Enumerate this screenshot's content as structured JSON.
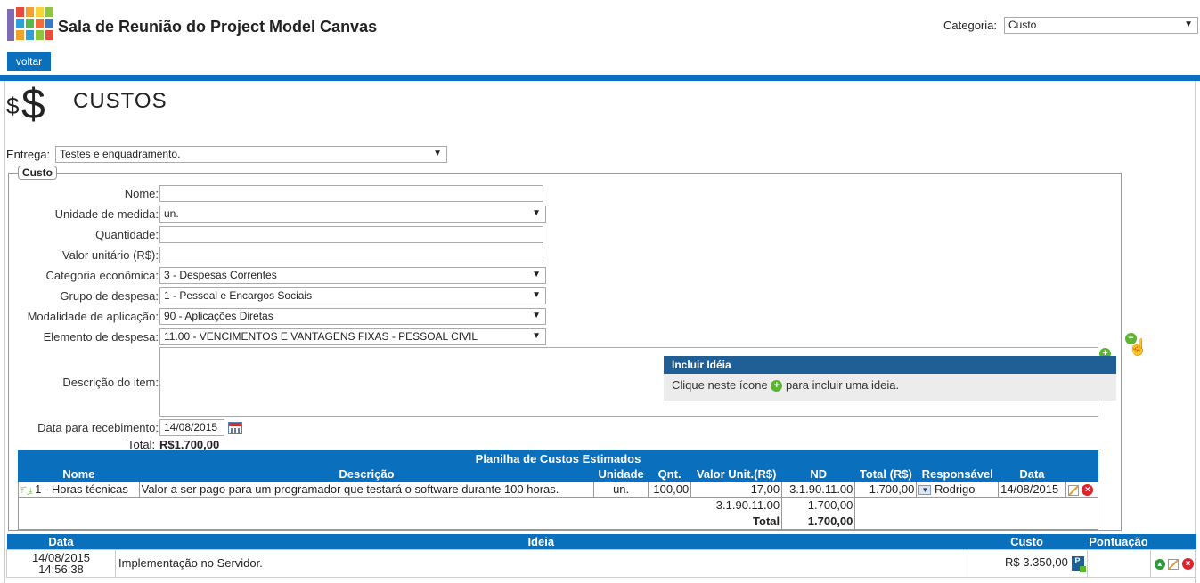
{
  "app": {
    "title": "Sala de Reunião do Project Model Canvas"
  },
  "header": {
    "category_label": "Categoria:",
    "category_value": "Custo",
    "back_button": "voltar"
  },
  "section": {
    "dollar_small": "$",
    "dollar_large": "$",
    "title": "CUSTOS"
  },
  "entrega": {
    "label": "Entrega:",
    "value": "Testes e enquadramento."
  },
  "form": {
    "legend": "Custo",
    "fields": {
      "nome": {
        "label": "Nome:",
        "value": ""
      },
      "unidade": {
        "label": "Unidade de medida:",
        "value": "un."
      },
      "quantidade": {
        "label": "Quantidade:",
        "value": ""
      },
      "valor_unitario": {
        "label": "Valor unitário (R$):",
        "value": ""
      },
      "categoria_economica": {
        "label": "Categoria econômica:",
        "value": "3 - Despesas Correntes"
      },
      "grupo_despesa": {
        "label": "Grupo de despesa:",
        "value": "1 - Pessoal e Encargos Sociais"
      },
      "modalidade": {
        "label": "Modalidade de aplicação:",
        "value": "90 - Aplicações Diretas"
      },
      "elemento": {
        "label": "Elemento de despesa:",
        "value": "11.00 - VENCIMENTOS E VANTAGENS FIXAS - PESSOAL CIVIL"
      },
      "descricao": {
        "label": "Descrição do item:",
        "value": ""
      },
      "data_recebimento": {
        "label": "Data para recebimento:",
        "value": "14/08/2015"
      }
    },
    "total_label": "Total:",
    "total_value": "R$1.700,00"
  },
  "tooltip": {
    "title": "Incluir Idéia",
    "text_before": "Clique neste ícone",
    "text_after": "para incluir uma ideia."
  },
  "planilha": {
    "title": "Planilha de Custos Estimados",
    "headers": [
      "Nome",
      "Descrição",
      "Unidade",
      "Qnt.",
      "Valor Unit.(R$)",
      "ND",
      "Total (R$)",
      "Responsável",
      "Data"
    ],
    "rows": [
      {
        "nome": "1 - Horas técnicas",
        "descricao": "Valor a ser pago para um programador que testará o software durante 100 horas.",
        "unidade": "un.",
        "qnt": "100,00",
        "valor_unit": "17,00",
        "nd": "3.1.90.11.00",
        "total": "1.700,00",
        "responsavel": "Rodrigo",
        "data": "14/08/2015"
      }
    ],
    "summary": {
      "nd": "3.1.90.11.00",
      "nd_total": "1.700,00",
      "total_label": "Total",
      "total_value": "1.700,00"
    }
  },
  "ideias": {
    "headers": [
      "Data",
      "Ideia",
      "Custo",
      "Pontuação"
    ],
    "rows": [
      {
        "date": "14/08/2015",
        "time": "14:56:38",
        "ideia": "Implementação no Servidor.",
        "custo": "R$ 3.350,00",
        "pontuacao": ""
      }
    ]
  },
  "icons": {
    "logo": "canvas-grid-logo",
    "add": "plus-circle-icon",
    "calendar": "calendar-icon",
    "edit": "edit-icon",
    "delete": "delete-icon",
    "pointer": "hand-cursor-icon"
  },
  "colors": {
    "primary": "#0a6fbd",
    "tooltip_header": "#1f5f96",
    "add_green": "#5cb531",
    "delete_red": "#d9262c"
  }
}
